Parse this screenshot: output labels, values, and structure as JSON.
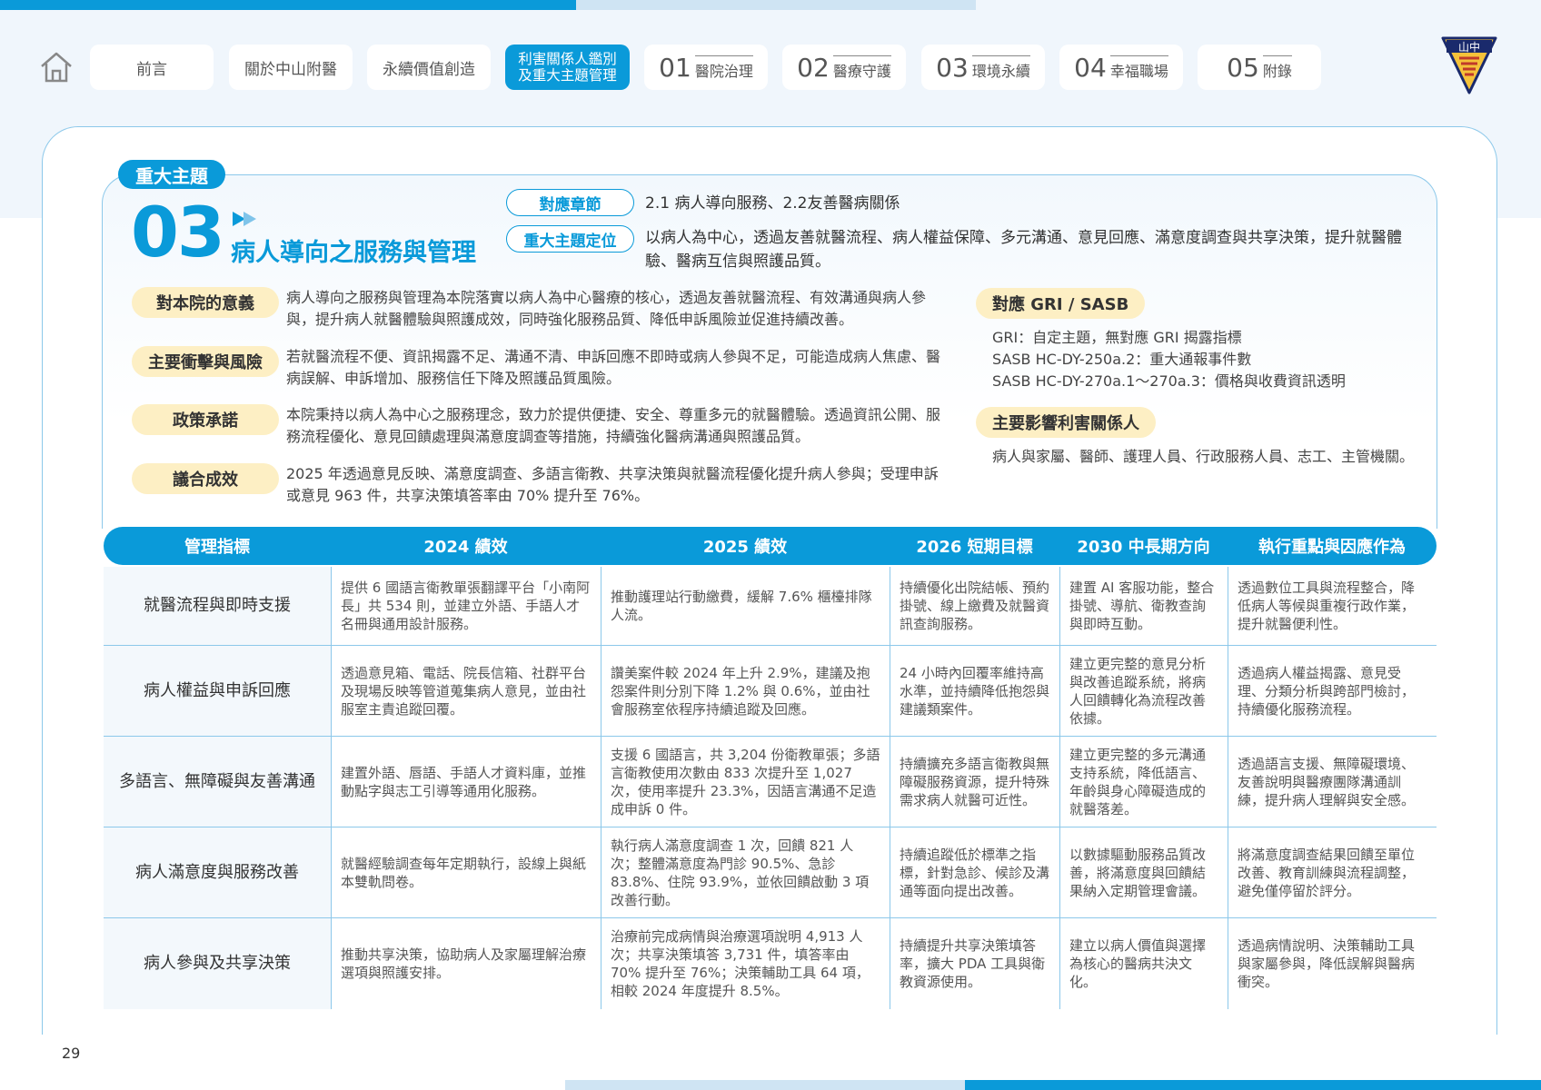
{
  "nav": {
    "tabs": [
      "前言",
      "關於中山附醫",
      "永續價值創造"
    ],
    "active_tab_line1": "利害關係人鑑別",
    "active_tab_line2": "及重大主題管理",
    "chapters": [
      {
        "num": "01",
        "title": "醫院治理"
      },
      {
        "num": "02",
        "title": "醫療守護"
      },
      {
        "num": "03",
        "title": "環境永續"
      },
      {
        "num": "04",
        "title": "幸福職場"
      },
      {
        "num": "05",
        "title": "附錄"
      }
    ],
    "logo_text": "山中"
  },
  "topic": {
    "badge": "重大主題",
    "number": "03",
    "title": "病人導向之服務與管理",
    "chapter_label": "對應章節",
    "chapter_value": "2.1 病人導向服務、2.2友善醫病關係",
    "position_label": "重大主題定位",
    "position_value_1": "以病人為中心，透過友善就醫流程、病人權益保障、多元溝通、意見回應、滿意度調查與共享決策，提升就醫體",
    "position_value_2": "驗、醫病互信與照護品質。"
  },
  "left_items": [
    {
      "label": "對本院的意義",
      "line1": "病人導向之服務與管理為本院落實以病人為中心醫療的核心，透過友善就醫流程、有效溝通與病人參",
      "line2": "與，提升病人就醫體驗與照護成效，同時強化服務品質、降低申訴風險並促進持續改善。"
    },
    {
      "label": "主要衝擊與風險",
      "line1": "若就醫流程不便、資訊揭露不足、溝通不清、申訴回應不即時或病人參與不足，可能造成病人焦慮、醫",
      "line2": "病誤解、申訴增加、服務信任下降及照護品質風險。"
    },
    {
      "label": "政策承諾",
      "line1": "本院秉持以病人為中心之服務理念，致力於提供便捷、安全、尊重多元的就醫體驗。透過資訊公開、服",
      "line2": "務流程優化、意見回饋處理與滿意度調查等措施，持續強化醫病溝通與照護品質。"
    },
    {
      "label": "議合成效",
      "line1": "2025 年透過意見反映、滿意度調查、多語言衛教、共享決策與就醫流程優化提升病人參與；受理申訴",
      "line2": "或意見 963 件，共享決策填答率由 70% 提升至 76%。"
    }
  ],
  "gri": {
    "label": "對應 GRI / SASB",
    "lines": [
      "GRI：自定主題，無對應 GRI 揭露指標",
      "SASB HC-DY-250a.2：重大通報事件數",
      "SASB HC-DY-270a.1～270a.3：價格與收費資訊透明"
    ]
  },
  "stakeholders": {
    "label": "主要影響利害關係人",
    "text": "病人與家屬、醫師、護理人員、行政服務人員、志工、主管機關。"
  },
  "table": {
    "headers": [
      "管理指標",
      "2024 績效",
      "2025 績效",
      "2026 短期目標",
      "2030 中長期方向",
      "執行重點與因應作為"
    ],
    "rows": [
      [
        "就醫流程與即時支援",
        "提供 6 國語言衛教單張翻譯平台「小南阿長」共 534 則，並建立外語、手語人才名冊與通用設計服務。",
        "推動護理站行動繳費，緩解 7.6% 櫃檯排隊人流。",
        "持續優化出院結帳、預約掛號、線上繳費及就醫資訊查詢服務。",
        "建置 AI 客服功能，整合掛號、導航、衛教查詢與即時互動。",
        "透過數位工具與流程整合，降低病人等候與重複行政作業，提升就醫便利性。"
      ],
      [
        "病人權益與申訴回應",
        "透過意見箱、電話、院長信箱、社群平台及現場反映等管道蒐集病人意見，並由社服室主責追蹤回覆。",
        "讚美案件較 2024 年上升 2.9%，建議及抱怨案件則分別下降 1.2% 與 0.6%，並由社會服務室依程序持續追蹤及回應。",
        "24 小時內回覆率維持高水準，並持續降低抱怨與建議類案件。",
        "建立更完整的意見分析與改善追蹤系統，將病人回饋轉化為流程改善依據。",
        "透過病人權益揭露、意見受理、分類分析與跨部門檢討，持續優化服務流程。"
      ],
      [
        "多語言、無障礙與友善溝通",
        "建置外語、唇語、手語人才資料庫，並推動點字與志工引導等通用化服務。",
        "支援 6 國語言，共 3,204 份衛教單張；多語言衛教使用次數由 833 次提升至 1,027 次，使用率提升 23.3%，因語言溝通不足造成申訴 0 件。",
        "持續擴充多語言衛教與無障礙服務資源，提升特殊需求病人就醫可近性。",
        "建立更完整的多元溝通支持系統，降低語言、年齡與身心障礙造成的就醫落差。",
        "透過語言支援、無障礙環境、友善說明與醫療團隊溝通訓練，提升病人理解與安全感。"
      ],
      [
        "病人滿意度與服務改善",
        "就醫經驗調查每年定期執行，設線上與紙本雙軌問卷。",
        "執行病人滿意度調查 1 次，回饋 821 人次；整體滿意度為門診 90.5%、急診 83.8%、住院 93.9%，並依回饋啟動 3 項改善行動。",
        "持續追蹤低於標準之指標，針對急診、候診及溝通等面向提出改善。",
        "以數據驅動服務品質改善，將滿意度與回饋結果納入定期管理會議。",
        "將滿意度調查結果回饋至單位改善、教育訓練與流程調整，避免僅停留於評分。"
      ],
      [
        "病人參與及共享決策",
        "推動共享決策，協助病人及家屬理解治療選項與照護安排。",
        "治療前完成病情與治療選項說明 4,913 人次；共享決策填答 3,731 件，填答率由 70% 提升至 76%；決策輔助工具 64 項，相較 2024 年度提升 8.5%。",
        "持續提升共享決策填答率，擴大 PDA 工具與衛教資源使用。",
        "建立以病人價值與選擇為核心的醫病共決文化。",
        "透過病情說明、決策輔助工具與家屬參與，降低誤解與醫病衝突。"
      ]
    ]
  },
  "page_number": "29",
  "colors": {
    "accent": "#0a9ad9",
    "label_bg": "#fdefc4",
    "line": "#8cc8ea"
  }
}
